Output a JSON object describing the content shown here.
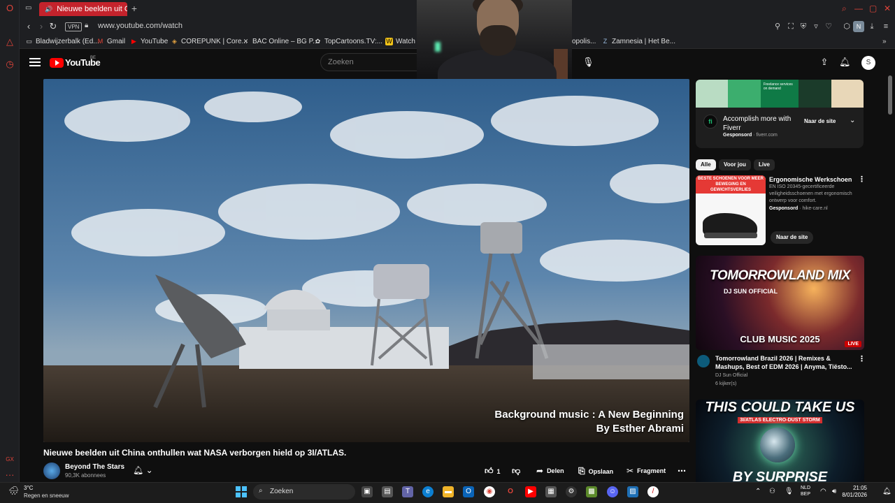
{
  "browser": {
    "active_tab_title": "Nieuwe beelden uit Chi",
    "url": "www.youtube.com/watch",
    "vpn_label": "VPN",
    "bookmarks": [
      {
        "label": "Bladwijzerbalk (Ed...",
        "icon": "folder-icon"
      },
      {
        "label": "Gmail",
        "icon": "gmail-icon"
      },
      {
        "label": "YouTube",
        "icon": "youtube-icon"
      },
      {
        "label": "COREPUNK | Core...",
        "icon": "corepunk-icon"
      },
      {
        "label": "BAC Online – BG P...",
        "icon": "bac-icon"
      },
      {
        "label": "TopCartoons.TV:...",
        "icon": "topcartoons-icon"
      },
      {
        "label": "Watch S",
        "icon": "watch-icon"
      },
      {
        "label": "opolis...",
        "icon": "page-icon"
      },
      {
        "label": "Zamnesia | Het Be...",
        "icon": "zamnesia-icon"
      }
    ],
    "profile_initial": "N"
  },
  "youtube": {
    "logo_text": "YouTube",
    "region": "BE",
    "search_placeholder": "Zoeken",
    "avatar_initial": "S"
  },
  "video": {
    "caption_line1": "Background music : A New Beginning",
    "caption_line2": "By Esther Abrami",
    "title": "Nieuwe beelden uit China onthullen wat NASA verborgen hield op 3I/ATLAS.",
    "channel_name": "Beyond The Stars",
    "subscribers": "90,3K abonnees",
    "like_count": "1",
    "share_label": "Delen",
    "save_label": "Opslaan",
    "clip_label": "Fragment"
  },
  "sidebar": {
    "ad": {
      "title": "Accomplish more with Fiverr",
      "sponsored": "Gesponsord",
      "domain": "fiverr.com",
      "cta": "Naar de site",
      "banner_text": "Freelance services on demand",
      "logo_letter": "fi"
    },
    "chips": [
      "Alle",
      "Voor jou",
      "Live"
    ],
    "shoe_ad": {
      "thumb_headline": "BESTE SCHOENEN VOOR MEER BEWEGING EN GEWICHTSVERLIES",
      "title": "Ergonomische Werkschoen",
      "description": "EN ISO 20345-gecertificeerde veiligheidsschoenen met ergonomisch ontwerp voor comfort.",
      "sponsored": "Gesponsord",
      "domain": "hike-care.nl",
      "cta": "Naar de site"
    },
    "live_video": {
      "thumb_title": "TOMORROWLAND MIX",
      "thumb_sub": "DJ SUN OFFICIAL",
      "thumb_footer": "CLUB MUSIC 2025",
      "live_badge": "LIVE",
      "title": "Tomorrowland Brazil 2026 | Remixes & Mashups, Best of EDM 2026 | Anyma, Tiësto...",
      "channel": "DJ Sun Official",
      "viewers": "6 kijker(s)"
    },
    "next_video": {
      "thumb_title": "THIS COULD TAKE US",
      "thumb_sub": "3I/ATLAS ELECTRO-DUST STORM",
      "thumb_bottom": "BY SURPRISE"
    }
  },
  "taskbar": {
    "temperature": "3°C",
    "condition": "Regen en sneeuw",
    "search_placeholder": "Zoeken",
    "lang_line1": "NLD",
    "lang_line2": "BEP",
    "time": "21:05",
    "date": "8/01/2026"
  },
  "colors": {
    "opera_red": "#c4232c",
    "youtube_red": "#ff0000",
    "background": "#0f0f0f",
    "windows_blue": "#4cc2ff"
  }
}
